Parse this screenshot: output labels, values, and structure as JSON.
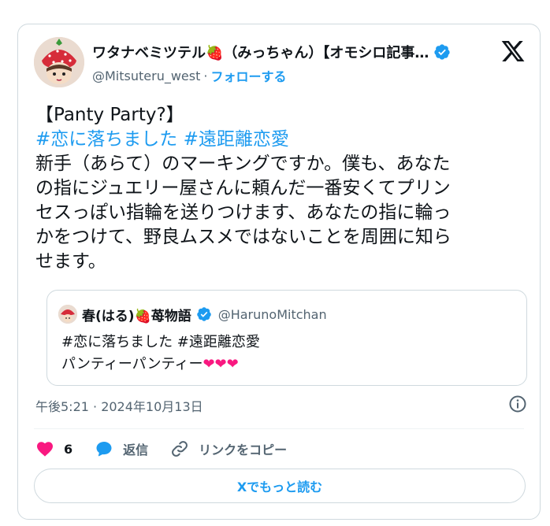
{
  "author": {
    "display_name": "ワタナベミツテル🍓（みっちゃん）【オモシロ記事…",
    "handle": "@Mitsuteru_west",
    "separator": "·",
    "follow_label": "フォローする"
  },
  "tweet": {
    "lines": [
      "【Panty Party?】",
      "",
      "新手（あらて）のマーキングですか。僕も、あなた",
      "の指にジュエリー屋さんに頼んだ一番安くてプリン",
      "セスっぽい指輪を送りつけます、あなたの指に輪っ",
      "かをつけて、野良ムスメではないことを周囲に知ら",
      "せます。"
    ],
    "hashtags": [
      "#恋に落ちました",
      "#遠距離恋愛"
    ]
  },
  "quote": {
    "display_name": "春(はる)🍓苺物語",
    "handle": "@HarunoMitchan",
    "line1": "#恋に落ちました #遠距離恋愛",
    "line2": "パンティーパンティー",
    "hearts": "❤❤❤"
  },
  "meta": {
    "timestamp": "午後5:21 · 2024年10月13日"
  },
  "actions": {
    "like_count": "6",
    "reply_label": "返信",
    "copy_link_label": "リンクをコピー",
    "read_more_label": "Xでもっと読む"
  },
  "colors": {
    "accent": "#1d9bf0",
    "like": "#f91880",
    "muted": "#536471"
  }
}
